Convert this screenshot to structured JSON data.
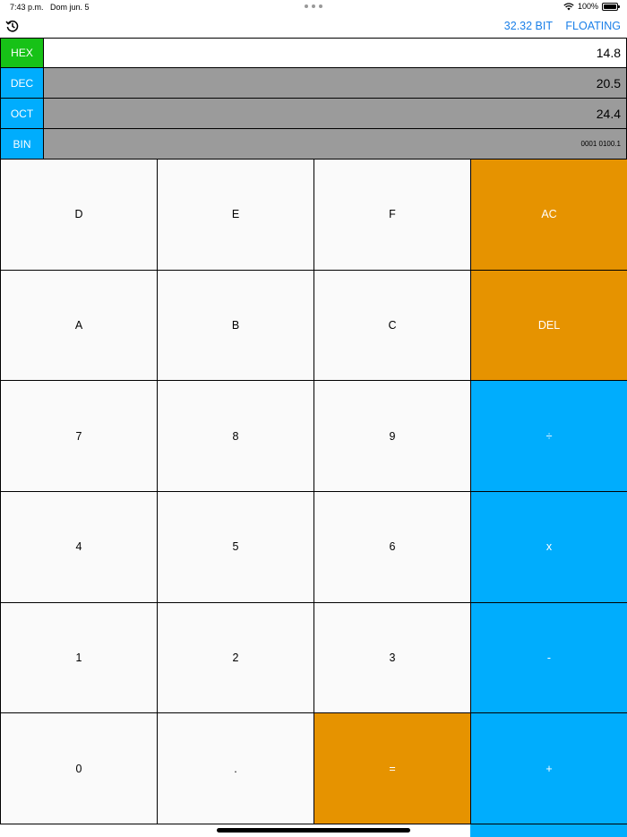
{
  "status_bar": {
    "time": "7:43 p.m.",
    "date": "Dom jun. 5",
    "battery": "100%"
  },
  "toolbar": {
    "history_icon": "history-icon",
    "bit_mode": "32.32 BIT",
    "float_mode": "FLOATING"
  },
  "display": {
    "rows": [
      {
        "label": "HEX",
        "value": "14.8",
        "label_color": "#17c217",
        "active": true
      },
      {
        "label": "DEC",
        "value": "20.5",
        "label_color": "#00adfd",
        "active": false
      },
      {
        "label": "OCT",
        "value": "24.4",
        "label_color": "#00adfd",
        "active": false
      },
      {
        "label": "BIN",
        "value": "0001 0100.1",
        "label_color": "#00adfd",
        "active": false
      }
    ]
  },
  "keypad": {
    "keys": [
      {
        "label": "D",
        "style": "plain"
      },
      {
        "label": "E",
        "style": "plain"
      },
      {
        "label": "F",
        "style": "plain"
      },
      {
        "label": "AC",
        "style": "orange"
      },
      {
        "label": "A",
        "style": "plain"
      },
      {
        "label": "B",
        "style": "plain"
      },
      {
        "label": "C",
        "style": "plain"
      },
      {
        "label": "DEL",
        "style": "orange"
      },
      {
        "label": "7",
        "style": "plain"
      },
      {
        "label": "8",
        "style": "plain"
      },
      {
        "label": "9",
        "style": "plain"
      },
      {
        "label": "÷",
        "style": "blue"
      },
      {
        "label": "4",
        "style": "plain"
      },
      {
        "label": "5",
        "style": "plain"
      },
      {
        "label": "6",
        "style": "plain"
      },
      {
        "label": "x",
        "style": "blue"
      },
      {
        "label": "1",
        "style": "plain"
      },
      {
        "label": "2",
        "style": "plain"
      },
      {
        "label": "3",
        "style": "plain"
      },
      {
        "label": "-",
        "style": "blue"
      },
      {
        "label": "0",
        "style": "plain"
      },
      {
        "label": ".",
        "style": "plain"
      },
      {
        "label": "=",
        "style": "orange"
      },
      {
        "label": "+",
        "style": "blue"
      }
    ]
  },
  "colors": {
    "accent_link": "#1a7fe8",
    "orange": "#e69300",
    "blue": "#00adfd",
    "green": "#17c217",
    "inactive_display": "#9b9b9b"
  }
}
